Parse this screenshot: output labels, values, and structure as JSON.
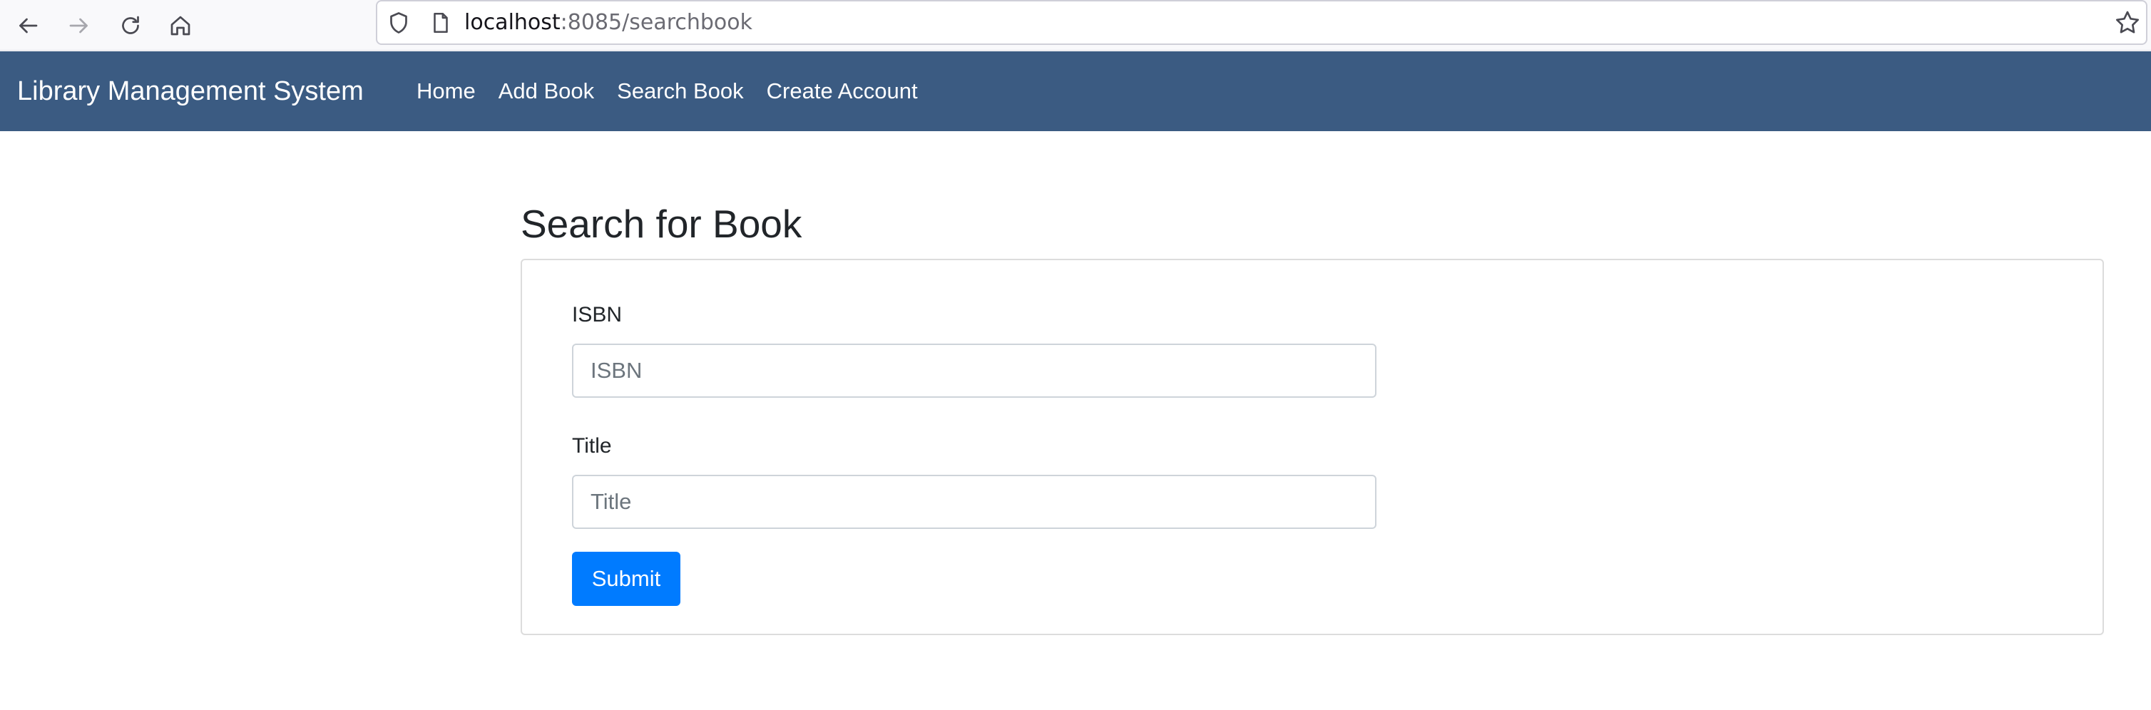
{
  "browser": {
    "url_host": "localhost",
    "url_rest": ":8085/searchbook",
    "icons": {
      "back": "arrow-left-icon",
      "forward": "arrow-right-icon",
      "reload": "reload-icon",
      "home": "home-icon",
      "shield": "shield-icon",
      "page": "page-icon",
      "bookmark": "star-icon"
    }
  },
  "navbar": {
    "brand": "Library Management System",
    "links": [
      {
        "label": "Home"
      },
      {
        "label": "Add Book"
      },
      {
        "label": "Search Book"
      },
      {
        "label": "Create Account"
      }
    ],
    "background_color": "#3b5b82"
  },
  "main": {
    "title": "Search for Book",
    "form": {
      "isbn": {
        "label": "ISBN",
        "placeholder": "ISBN",
        "value": ""
      },
      "title": {
        "label": "Title",
        "placeholder": "Title",
        "value": ""
      },
      "submit_label": "Submit",
      "submit_color": "#007bff"
    }
  }
}
